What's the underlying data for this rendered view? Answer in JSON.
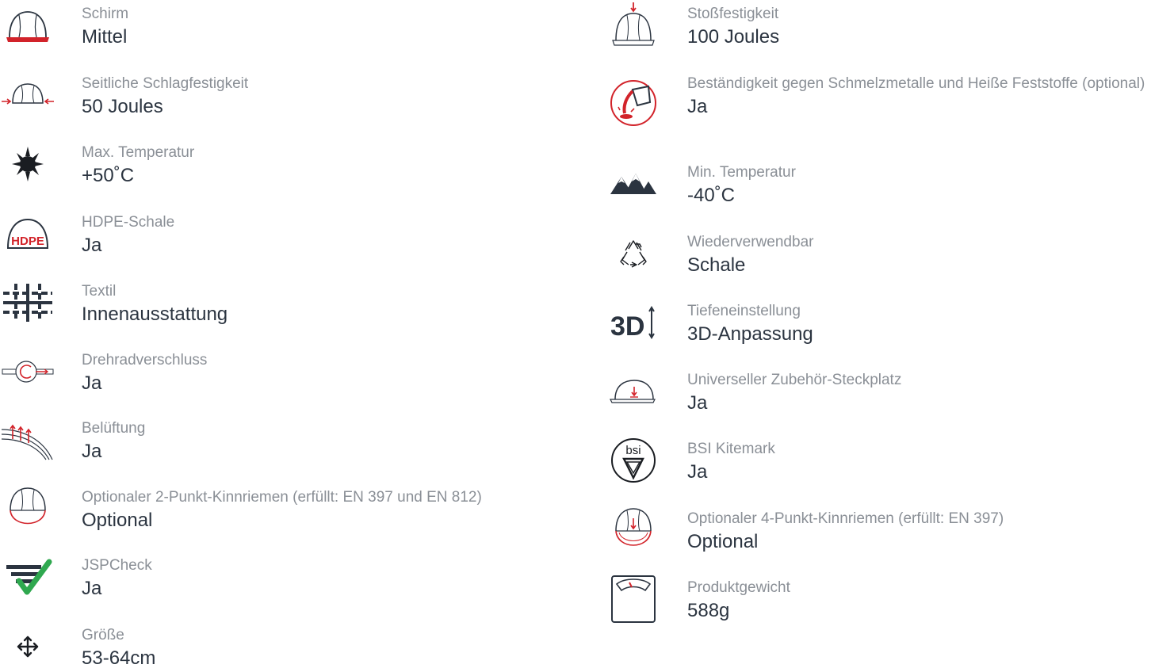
{
  "left": [
    {
      "label": "Schirm",
      "value": "Mittel",
      "icon": "helmet-peak-icon"
    },
    {
      "label": "Seitliche Schlagfestigkeit",
      "value": "50 Joules",
      "icon": "helmet-side-impact-icon"
    },
    {
      "label": "Max. Temperatur",
      "value": "+50˚C",
      "icon": "sun-icon"
    },
    {
      "label": "HDPE-Schale",
      "value": "Ja",
      "icon": "hdpe-helmet-icon",
      "icon_text": "HDPE"
    },
    {
      "label": "Textil",
      "value": "Innenausstattung",
      "icon": "textile-grid-icon"
    },
    {
      "label": "Drehradverschluss",
      "value": "Ja",
      "icon": "wheel-ratchet-icon"
    },
    {
      "label": "Belüftung",
      "value": "Ja",
      "icon": "ventilation-icon"
    },
    {
      "label": "Optionaler 2-Punkt-Kinnriemen (erfüllt: EN 397 und EN 812)",
      "value": "Optional",
      "icon": "helmet-chinstrap-2pt-icon"
    },
    {
      "label": "JSPCheck",
      "value": "Ja",
      "icon": "jspcheck-icon"
    },
    {
      "label": "Größe",
      "value": "53-64cm",
      "icon": "size-arrows-icon"
    }
  ],
  "right": [
    {
      "label": "Stoßfestigkeit",
      "value": "100 Joules",
      "icon": "helmet-top-impact-icon"
    },
    {
      "label": "Beständigkeit gegen Schmelzmetalle und Heiße Feststoffe (optional)",
      "value": "Ja",
      "icon": "molten-metal-icon"
    },
    {
      "label": "Min. Temperatur",
      "value": "-40˚C",
      "icon": "mountains-icon"
    },
    {
      "label": "Wiederverwendbar",
      "value": "Schale",
      "icon": "recycle-icon"
    },
    {
      "label": "Tiefeneinstellung",
      "value": "3D-Anpassung",
      "icon": "3d-adjust-icon",
      "icon_text": "3D"
    },
    {
      "label": "Universeller Zubehör-Steckplatz",
      "value": "Ja",
      "icon": "accessory-slot-icon"
    },
    {
      "label": "BSI Kitemark",
      "value": "Ja",
      "icon": "bsi-kitemark-icon",
      "icon_text": "bsi"
    },
    {
      "label": "Optionaler 4-Punkt-Kinnriemen (erfüllt: EN 397)",
      "value": "Optional",
      "icon": "helmet-chinstrap-4pt-icon"
    },
    {
      "label": "Produktgewicht",
      "value": "588g",
      "icon": "scale-icon"
    }
  ],
  "colors": {
    "label": "#8a8f96",
    "value": "#2b3440",
    "icon_dark": "#2b3440",
    "accent_red": "#d2232a",
    "check_green": "#2fa84f"
  }
}
